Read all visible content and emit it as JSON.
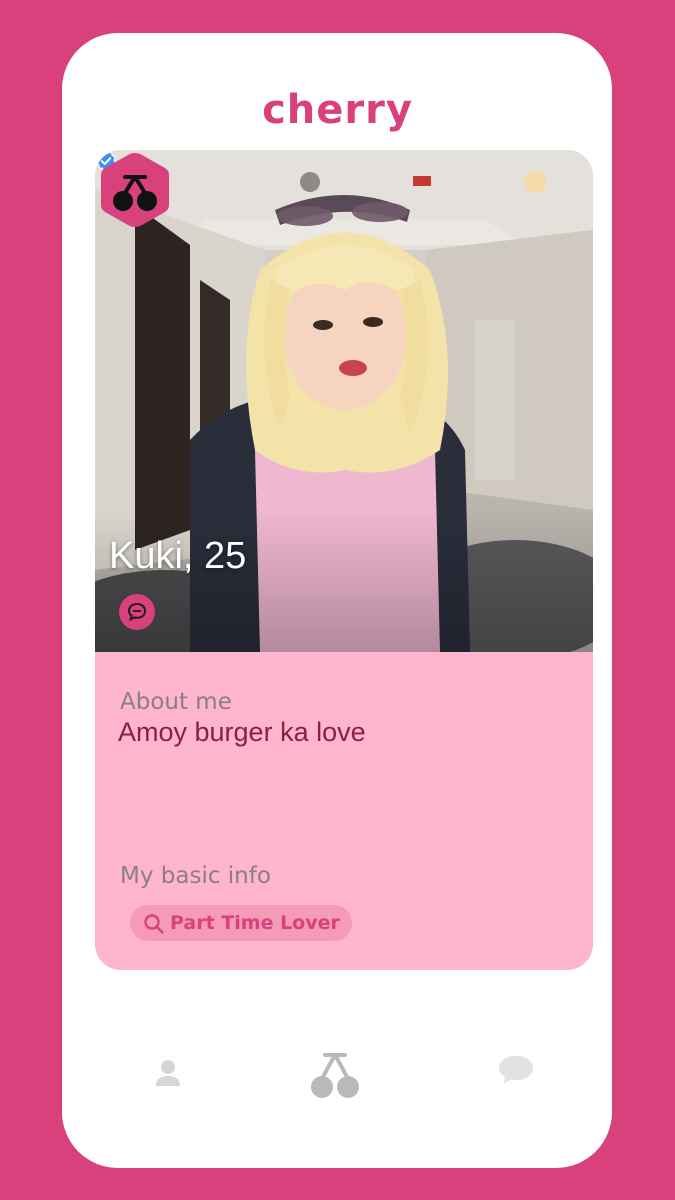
{
  "app": {
    "title": "cherry",
    "accent_color": "#d9417c",
    "card_color": "#ffb5cb"
  },
  "profile": {
    "name_age": "Kuki, 25",
    "verified": true,
    "verified_icon": "verified-badge-icon",
    "about_label": "About me",
    "about_text": "Amoy burger ka love",
    "basic_info_label": "My basic info",
    "tags": [
      {
        "icon": "search-icon",
        "label": "Part Time Lover"
      }
    ]
  },
  "nav": {
    "items": [
      {
        "icon": "profile-icon",
        "active": false
      },
      {
        "icon": "cherry-icon",
        "active": true
      },
      {
        "icon": "chat-icon",
        "active": false
      }
    ]
  }
}
